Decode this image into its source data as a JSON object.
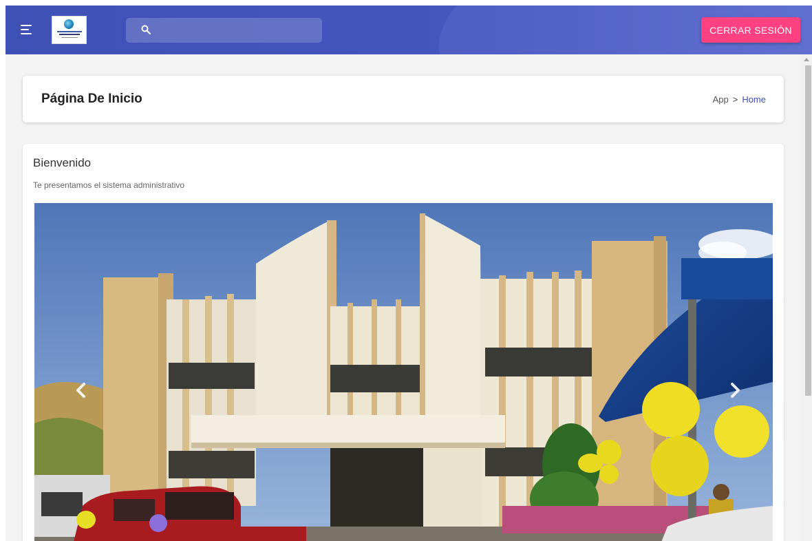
{
  "appbar": {
    "search": {
      "placeholder": "",
      "value": ""
    },
    "logout_label": "CERRAR SESIÓN",
    "icons": {
      "menu": "menu-icon",
      "search": "search-icon"
    },
    "colors": {
      "primary": "#3f51b5",
      "accent": "#ff4081"
    }
  },
  "page": {
    "title": "Página De Inicio",
    "breadcrumb": {
      "root": "App",
      "separator": ">",
      "current": "Home"
    }
  },
  "welcome": {
    "title": "Bienvenido",
    "subtitle": "Te presentamos el sistema administrativo"
  },
  "carousel": {
    "prev_icon": "chevron-left-icon",
    "next_icon": "chevron-right-icon"
  }
}
